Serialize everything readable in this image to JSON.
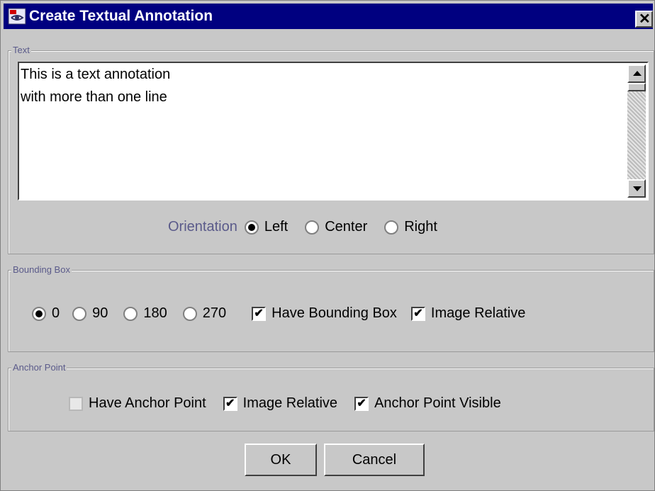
{
  "window": {
    "title": "Create Textual Annotation",
    "title_bg": "#000080"
  },
  "text_group": {
    "legend": "Text",
    "lines": [
      "This is a text annotation",
      "with more than one line"
    ],
    "orientation_label": "Orientation",
    "orientation_options": [
      "Left",
      "Center",
      "Right"
    ],
    "orientation_selected": "Left"
  },
  "bbox_group": {
    "legend": "Bounding Box",
    "angles": [
      "0",
      "90",
      "180",
      "270"
    ],
    "angle_selected": "0",
    "have_bbox_label": "Have Bounding Box",
    "have_bbox_checked": true,
    "image_relative_label": "Image Relative",
    "image_relative_checked": true
  },
  "anchor_group": {
    "legend": "Anchor Point",
    "have_anchor_label": "Have Anchor Point",
    "have_anchor_checked": false,
    "image_relative_label": "Image Relative",
    "image_relative_checked": true,
    "anchor_visible_label": "Anchor Point Visible",
    "anchor_visible_checked": true
  },
  "buttons": {
    "ok": "OK",
    "cancel": "Cancel"
  }
}
